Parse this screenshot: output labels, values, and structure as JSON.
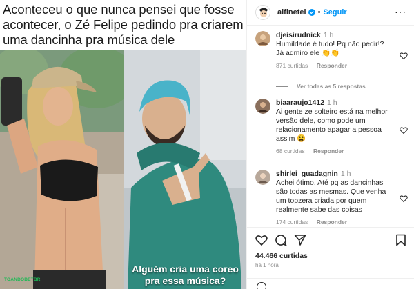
{
  "post": {
    "headline": "Aconteceu o que nunca pensei que fosse acontecer, o Zé Felipe pedindo pra criarem uma dancinha pra música dele",
    "bottom_caption": "Alguém cria uma coreo pra essa música?",
    "watermark": "TOANDOBETBR"
  },
  "header": {
    "username": "alfinetei",
    "follow_label": "Seguir",
    "dot": "•"
  },
  "comments": [
    {
      "username": "djeisirudnick",
      "text": "Humildade é tudo! Pq não pedir!? Já admiro ele 👏👏",
      "time": "1 h",
      "likes": "871 curtidas",
      "reply": "Responder",
      "avatar_color": "#c7a27c"
    },
    {
      "username": "biaaraujo1412",
      "text": "Ai gente ze solteiro está na melhor versão dele, como pode um relacionamento apagar a pessoa assim 😩",
      "time": "1 h",
      "likes": "68 curtidas",
      "reply": "Responder",
      "avatar_color": "#8a6f5c"
    },
    {
      "username": "shirlei_guadagnin",
      "text": "Achei ótimo. Até pq as dancinhas são todas as mesmas. Que venha um topzera criada por quem realmente sabe das coisas",
      "time": "1 h",
      "likes": "174 curtidas",
      "reply": "Responder",
      "avatar_color": "#b8a89a"
    }
  ],
  "view_replies": "Ver todas as 5 respostas",
  "footer": {
    "likes_count": "44.466 curtidas",
    "posted": "há 1 hora",
    "add_comment_placeholder": ""
  },
  "colors": {
    "accent": "#0095f6",
    "text": "#262626",
    "muted": "#8e8e8e"
  }
}
